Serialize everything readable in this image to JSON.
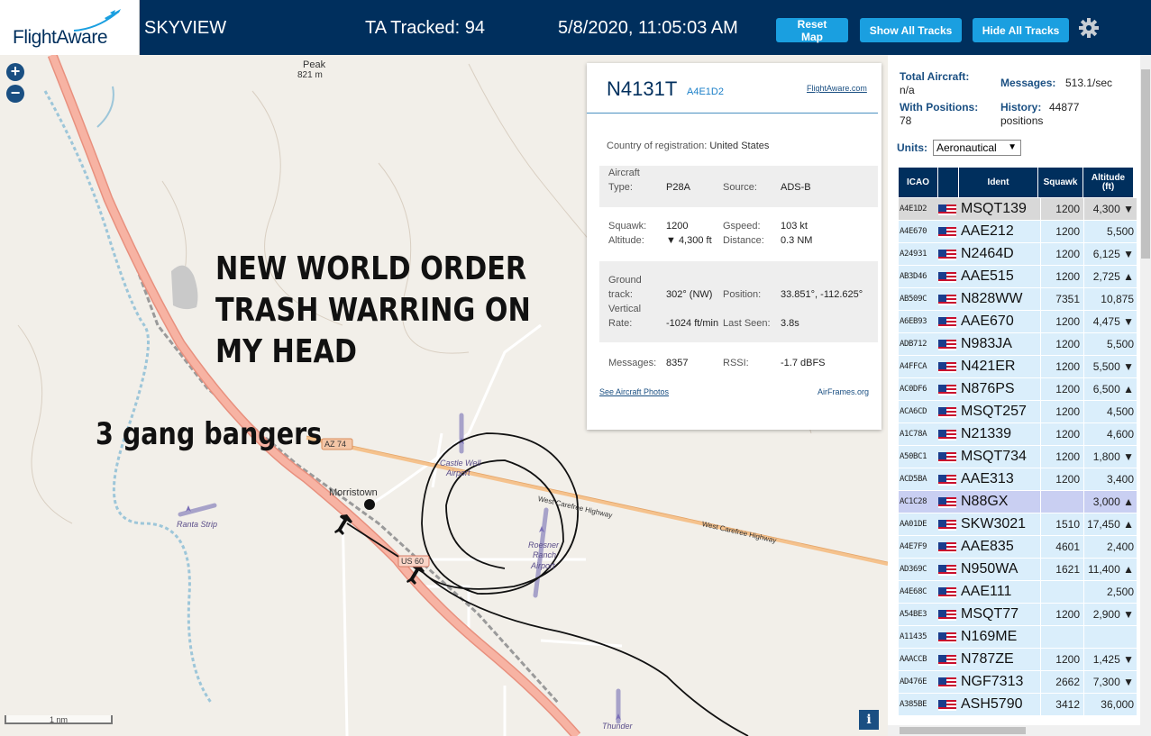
{
  "header": {
    "logo_text": "FlightAware",
    "app_name": "SKYVIEW",
    "tracked": "TA Tracked: 94",
    "clock": "5/8/2020, 11:05:03 AM",
    "buttons": {
      "reset": "Reset Map",
      "show_all": "Show All Tracks",
      "hide_all": "Hide All Tracks"
    },
    "settings_icon": "gear-icon",
    "colors": {
      "bar": "#002f5d",
      "button": "#1a9fe0"
    }
  },
  "map": {
    "zoom_in": "+",
    "zoom_out": "−",
    "scale_label": "1 nm",
    "info_label": "i",
    "overlay_text_1": [
      "NEW WORLD ORDER",
      "TRASH WARRING ON",
      "MY HEAD"
    ],
    "overlay_text_2": "3 gang bangers",
    "labels": {
      "peak_name": "Peak",
      "peak_elev": "821 m",
      "morristown": "Morristown",
      "az74": "AZ 74",
      "us60": "US 60",
      "hwy1": "West Carefree Highway",
      "hwy2": "West Carefree Highway",
      "castle_well": [
        "Castle Well",
        "Airport"
      ],
      "ranta": "Ranta Strip",
      "roesner": [
        "Roesner",
        "Ranch",
        "Airport"
      ],
      "thunder": "Thunder"
    }
  },
  "popup": {
    "callsign": "N4131T",
    "icao": "A4E1D2",
    "fa_link": "FlightAware.com",
    "country_label": "Country of registration:",
    "country": "United States",
    "aircraft_type_label": [
      "Aircraft",
      "Type:"
    ],
    "aircraft_type": "P28A",
    "source_label": "Source:",
    "source": "ADS-B",
    "squawk_label": "Squawk:",
    "squawk": "1200",
    "gspeed_label": "Gspeed:",
    "gspeed": "103 kt",
    "altitude_label": "Altitude:",
    "altitude": "▼ 4,300 ft",
    "distance_label": "Distance:",
    "distance": "0.3 NM",
    "ground_track_label": [
      "Ground",
      "track:"
    ],
    "ground_track": "302° (NW)",
    "position_label": "Position:",
    "position": "33.851°, -112.625°",
    "vrate_label": [
      "Vertical",
      "Rate:"
    ],
    "vrate": "-1024 ft/min",
    "last_seen_label": "Last Seen:",
    "last_seen": "3.8s",
    "messages_label": "Messages:",
    "messages": "8357",
    "rssi_label": "RSSI:",
    "rssi": "-1.7 dBFS",
    "photos_link": "See Aircraft Photos",
    "airframes_link": "AirFrames.org"
  },
  "sidebar": {
    "total_label": "Total Aircraft:",
    "total_value": "n/a",
    "messages_label": "Messages:",
    "messages_value": "513.1/sec",
    "with_pos_label": "With Positions:",
    "with_pos_value": "78",
    "history_label": "History:",
    "history_value": "44877",
    "history_unit": "positions",
    "units_label": "Units:",
    "units_value": "Aeronautical",
    "columns": [
      "ICAO",
      "Ident",
      "Squawk",
      "Altitude (ft)"
    ],
    "rows": [
      {
        "icao": "A4E1D2",
        "ident": "MSQT139",
        "squawk": "1200",
        "alt": "4,300 ▼",
        "state": "sel"
      },
      {
        "icao": "A4E670",
        "ident": "AAE212",
        "squawk": "1200",
        "alt": "5,500",
        "state": ""
      },
      {
        "icao": "A24931",
        "ident": "N2464D",
        "squawk": "1200",
        "alt": "6,125 ▼",
        "state": ""
      },
      {
        "icao": "AB3D46",
        "ident": "AAE515",
        "squawk": "1200",
        "alt": "2,725 ▲",
        "state": ""
      },
      {
        "icao": "AB509C",
        "ident": "N828WW",
        "squawk": "7351",
        "alt": "10,875",
        "state": ""
      },
      {
        "icao": "A6EB93",
        "ident": "AAE670",
        "squawk": "1200",
        "alt": "4,475 ▼",
        "state": ""
      },
      {
        "icao": "ADB712",
        "ident": "N983JA",
        "squawk": "1200",
        "alt": "5,500",
        "state": ""
      },
      {
        "icao": "A4FFCA",
        "ident": "N421ER",
        "squawk": "1200",
        "alt": "5,500 ▼",
        "state": ""
      },
      {
        "icao": "AC0DF6",
        "ident": "N876PS",
        "squawk": "1200",
        "alt": "6,500 ▲",
        "state": ""
      },
      {
        "icao": "ACA6CD",
        "ident": "MSQT257",
        "squawk": "1200",
        "alt": "4,500",
        "state": ""
      },
      {
        "icao": "A1C78A",
        "ident": "N21339",
        "squawk": "1200",
        "alt": "4,600",
        "state": ""
      },
      {
        "icao": "A50BC1",
        "ident": "MSQT734",
        "squawk": "1200",
        "alt": "1,800 ▼",
        "state": ""
      },
      {
        "icao": "ACD5BA",
        "ident": "AAE313",
        "squawk": "1200",
        "alt": "3,400",
        "state": ""
      },
      {
        "icao": "AC1C28",
        "ident": "N88GX",
        "squawk": "",
        "alt": "3,000 ▲",
        "state": "hl"
      },
      {
        "icao": "AA01DE",
        "ident": "SKW3021",
        "squawk": "1510",
        "alt": "17,450 ▲",
        "state": ""
      },
      {
        "icao": "A4E7F9",
        "ident": "AAE835",
        "squawk": "4601",
        "alt": "2,400",
        "state": ""
      },
      {
        "icao": "AD369C",
        "ident": "N950WA",
        "squawk": "1621",
        "alt": "11,400 ▲",
        "state": ""
      },
      {
        "icao": "A4E68C",
        "ident": "AAE111",
        "squawk": "",
        "alt": "2,500",
        "state": ""
      },
      {
        "icao": "A54BE3",
        "ident": "MSQT77",
        "squawk": "1200",
        "alt": "2,900 ▼",
        "state": ""
      },
      {
        "icao": "A11435",
        "ident": "N169ME",
        "squawk": "",
        "alt": "",
        "state": ""
      },
      {
        "icao": "AAACCB",
        "ident": "N787ZE",
        "squawk": "1200",
        "alt": "1,425 ▼",
        "state": ""
      },
      {
        "icao": "AD476E",
        "ident": "NGF7313",
        "squawk": "2662",
        "alt": "7,300 ▼",
        "state": ""
      },
      {
        "icao": "A385BE",
        "ident": "ASH5790",
        "squawk": "3412",
        "alt": "36,000",
        "state": ""
      }
    ]
  }
}
